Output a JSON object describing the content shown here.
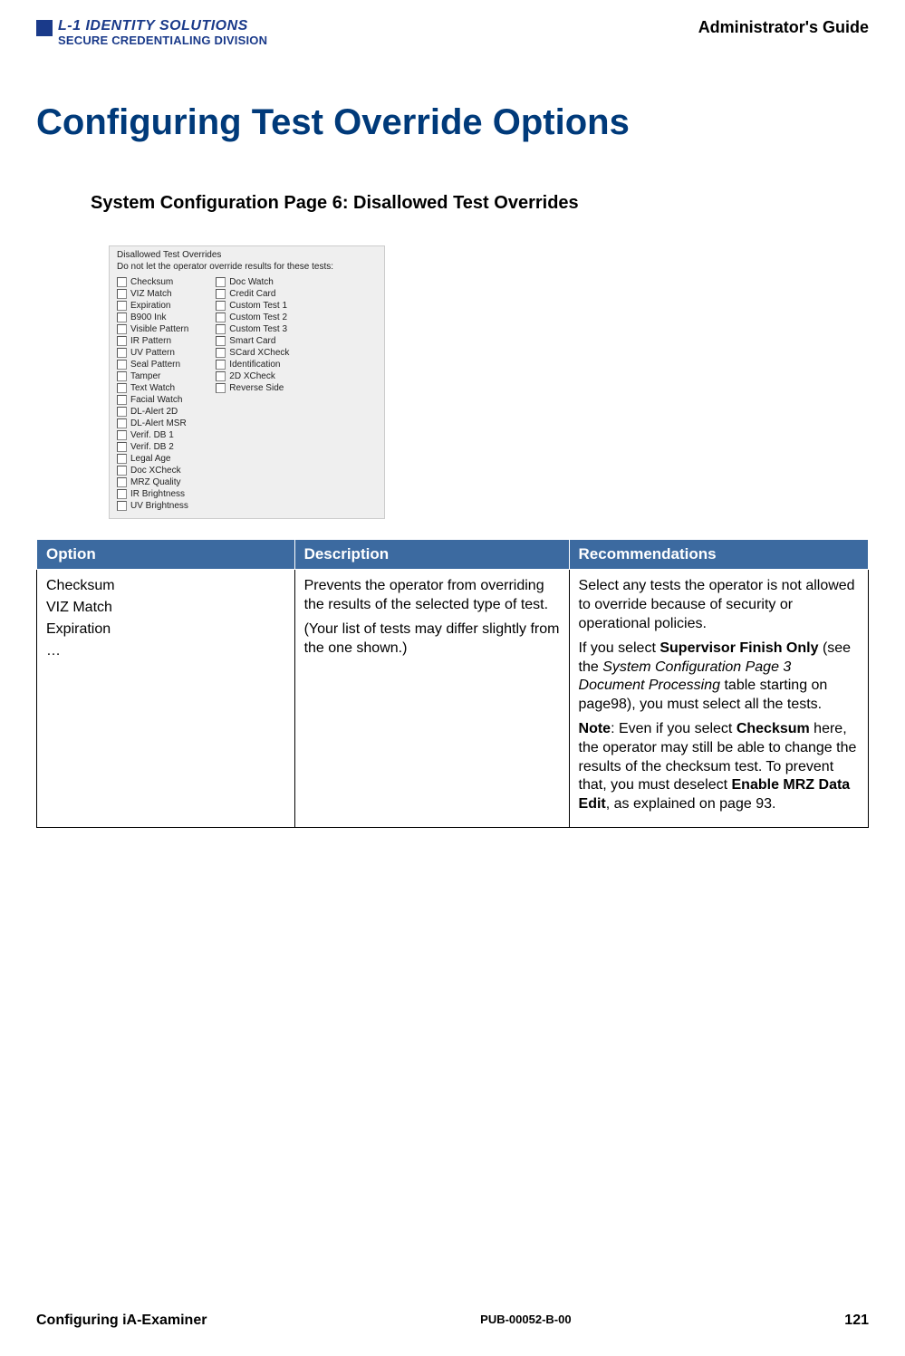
{
  "header": {
    "logo_line1": "L-1 IDENTITY SOLUTIONS",
    "logo_line2": "SECURE CREDENTIALING DIVISION",
    "guide": "Administrator's Guide"
  },
  "title": "Configuring Test Override Options",
  "subtitle": "System Configuration Page 6: Disallowed Test Overrides",
  "screenshot": {
    "group_label": "Disallowed Test Overrides",
    "description": "Do not let the operator override results for these tests:",
    "col1": [
      "Checksum",
      "VIZ Match",
      "Expiration",
      "B900 Ink",
      "Visible Pattern",
      "IR Pattern",
      "UV Pattern",
      "Seal Pattern",
      "Tamper",
      "Text Watch",
      "Facial Watch",
      "DL-Alert 2D",
      "DL-Alert MSR",
      "Verif. DB 1",
      "Verif. DB 2",
      "Legal Age",
      "Doc XCheck",
      "MRZ Quality",
      "IR Brightness",
      "UV Brightness"
    ],
    "col2": [
      "Doc Watch",
      "Credit Card",
      "Custom Test 1",
      "Custom Test 2",
      "Custom Test 3",
      "Smart Card",
      "SCard XCheck",
      "Identification",
      "2D XCheck",
      "Reverse Side"
    ]
  },
  "table": {
    "headers": {
      "c1": "Option",
      "c2": "Description",
      "c3": "Recommendations"
    },
    "row": {
      "options": [
        "Checksum",
        "VIZ Match",
        "Expiration",
        "…"
      ],
      "desc_p1": "Prevents the operator from overriding the results of the selected type of test.",
      "desc_p2": "(Your list of tests may differ slightly from the one shown.)",
      "rec_p1": "Select any tests the operator is not allowed to override because of security or operational policies.",
      "rec_p2a": "If you select ",
      "rec_p2b_bold": "Supervisor Finish Only",
      "rec_p2c": " (see the ",
      "rec_p2d_italic": "System Configuration Page 3 Document Processing",
      "rec_p2e": " table starting on page98), you must select all the tests.",
      "rec_p3a_bold": "Note",
      "rec_p3b": ": Even if you select ",
      "rec_p3c_bold": "Checksum",
      "rec_p3d": " here, the operator may still be able to change the results of the checksum test. To prevent that, you must deselect ",
      "rec_p3e_bold": "Enable MRZ Data Edit",
      "rec_p3f": ", as explained on page 93."
    }
  },
  "footer": {
    "left": "Configuring iA-Examiner",
    "center": "PUB-00052-B-00",
    "right": "121"
  }
}
